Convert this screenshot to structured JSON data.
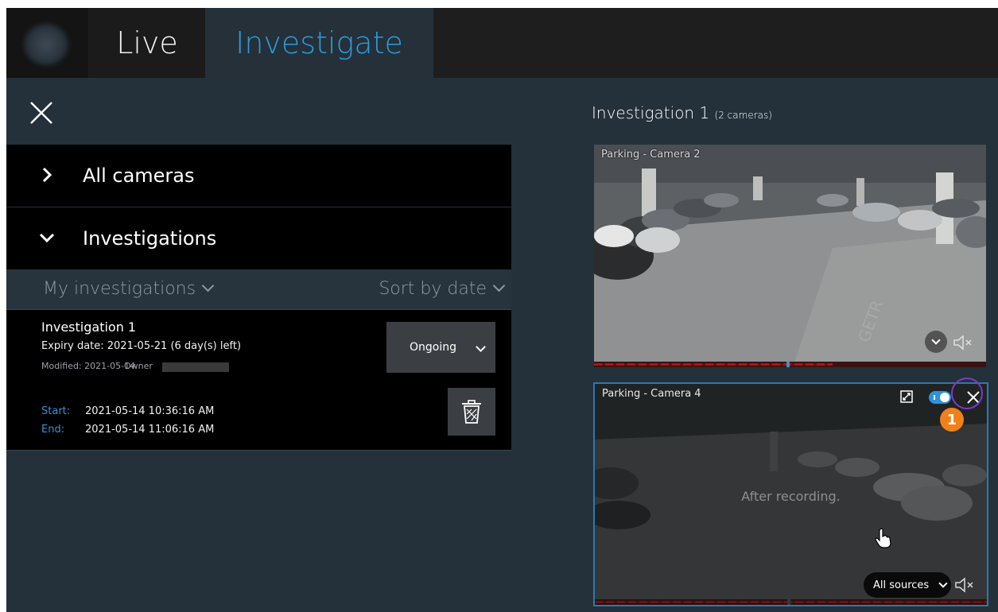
{
  "topbar": {
    "tabs": [
      {
        "label": "Live",
        "active": false
      },
      {
        "label": "Investigate",
        "active": true
      }
    ]
  },
  "left_panel": {
    "sections": [
      {
        "label": "All cameras",
        "expanded": false
      },
      {
        "label": "Investigations",
        "expanded": true
      }
    ],
    "filters": {
      "scope": "My investigations",
      "sort": "Sort by date"
    },
    "investigation": {
      "title": "Investigation 1",
      "expiry": "Expiry date: 2021-05-21 (6 day(s) left)",
      "modified": "Modified: 2021-05-14",
      "owner_label": "Owner",
      "status": "Ongoing",
      "start_label": "Start:",
      "start_value": "2021-05-14 10:36:16 AM",
      "end_label": "End:",
      "end_value": "2021-05-14 11:06:16 AM"
    }
  },
  "right_panel": {
    "header_title": "Investigation 1",
    "header_count": "(2 cameras)",
    "cameras": [
      {
        "name": "Parking - Camera 2"
      },
      {
        "name": "Parking - Camera 4",
        "overlay_text": "After recording.",
        "sources_label": "All sources",
        "selected": true
      }
    ],
    "callout_number": "1"
  },
  "colors": {
    "accent_blue": "#2c9bdc",
    "callout_orange": "#f0801a",
    "highlight_ring": "#7a3dc2",
    "panel_bg": "#24313b"
  }
}
